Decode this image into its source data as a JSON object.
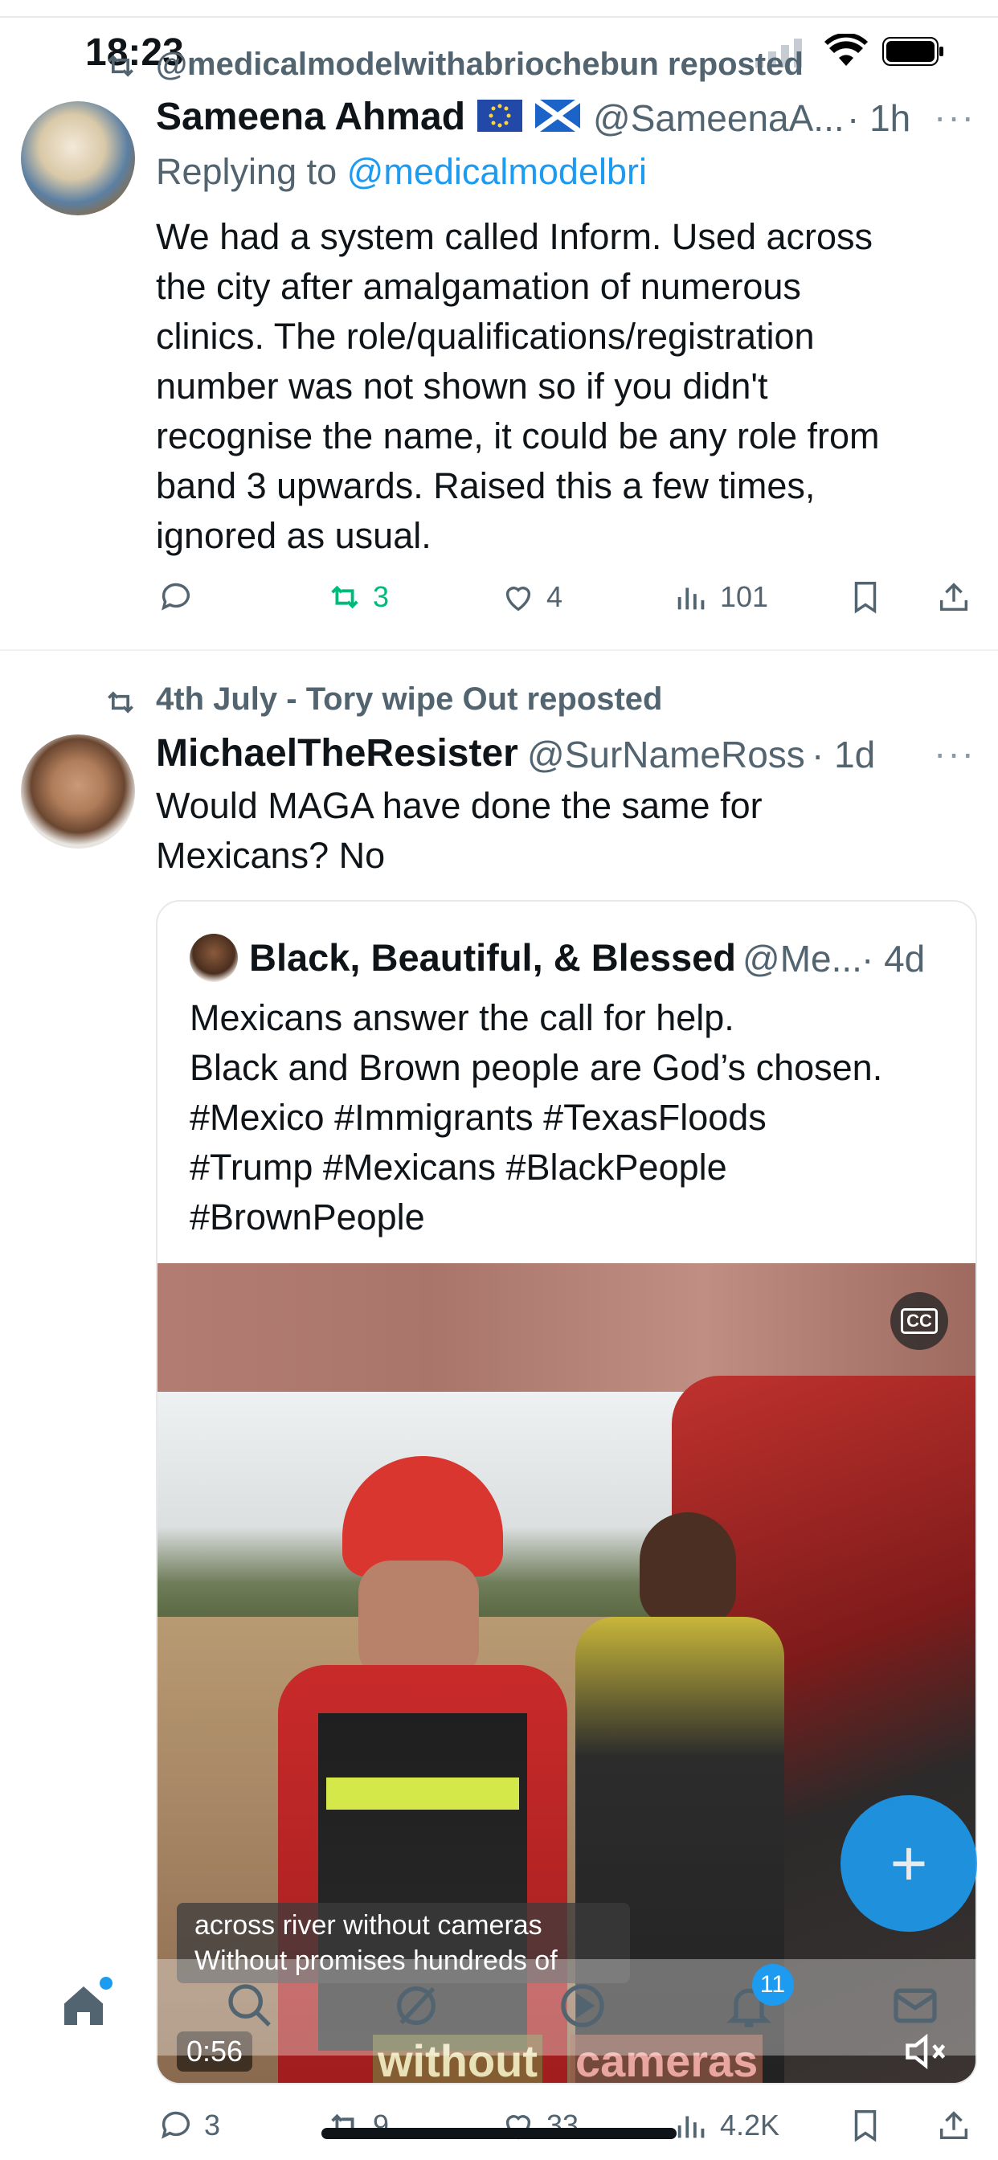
{
  "status": {
    "time": "18:23"
  },
  "post1": {
    "reposted_by": "@medicalmodelwithabriochebun reposted",
    "author_name": "Sameena Ahmad",
    "author_flags": "🇪🇺 🏴󠁧󠁢󠁳󠁣󠁴󠁿",
    "author_handle": "@SameenaA...",
    "time": "· 1h",
    "replying_prefix": "Replying to",
    "replying_to": "@medicalmodelbri",
    "lines": [
      "We had a system called Inform. Used across",
      "the city after amalgamation of numerous",
      "clinics. The role/qualifications/registration",
      "number was not shown so if you didn't",
      "recognise the name, it could be any role from",
      "band 3 upwards. Raised this a few times,",
      "ignored as usual."
    ],
    "actions": {
      "reposts": "3",
      "likes": "4",
      "views": "101"
    }
  },
  "post2": {
    "reposted_by": "4th July - Tory wipe Out reposted",
    "author_name": "MichaelTheResister",
    "author_handle": "@SurNameRoss",
    "time": "· 1d",
    "lines": [
      "Would MAGA have done the same for",
      "Mexicans? No"
    ],
    "quote": {
      "author_name": "Black, Beautiful, & Blessed",
      "author_handle": "@Me...",
      "time": "· 4d",
      "lines": [
        "Mexicans answer the call for help.",
        "Black and Brown people are God’s chosen.",
        "#Mexico  #Immigrants   #TexasFloods",
        "#Trump  #Mexicans  #BlackPeople",
        "#BrownPeople"
      ],
      "video": {
        "cc_label": "CC",
        "caption_line1": "across river without cameras",
        "caption_line2": "Without promises hundreds of",
        "burned_caption_a": "without",
        "burned_caption_b": "cameras",
        "duration": "0:56"
      }
    },
    "actions": {
      "replies": "3",
      "reposts": "9",
      "likes": "33",
      "views": "4.2K"
    }
  },
  "nav": {
    "notifications_badge": "11"
  },
  "colors": {
    "accent": "#1d9bf0",
    "repost_green": "#00ba7c",
    "muted": "#536471"
  }
}
